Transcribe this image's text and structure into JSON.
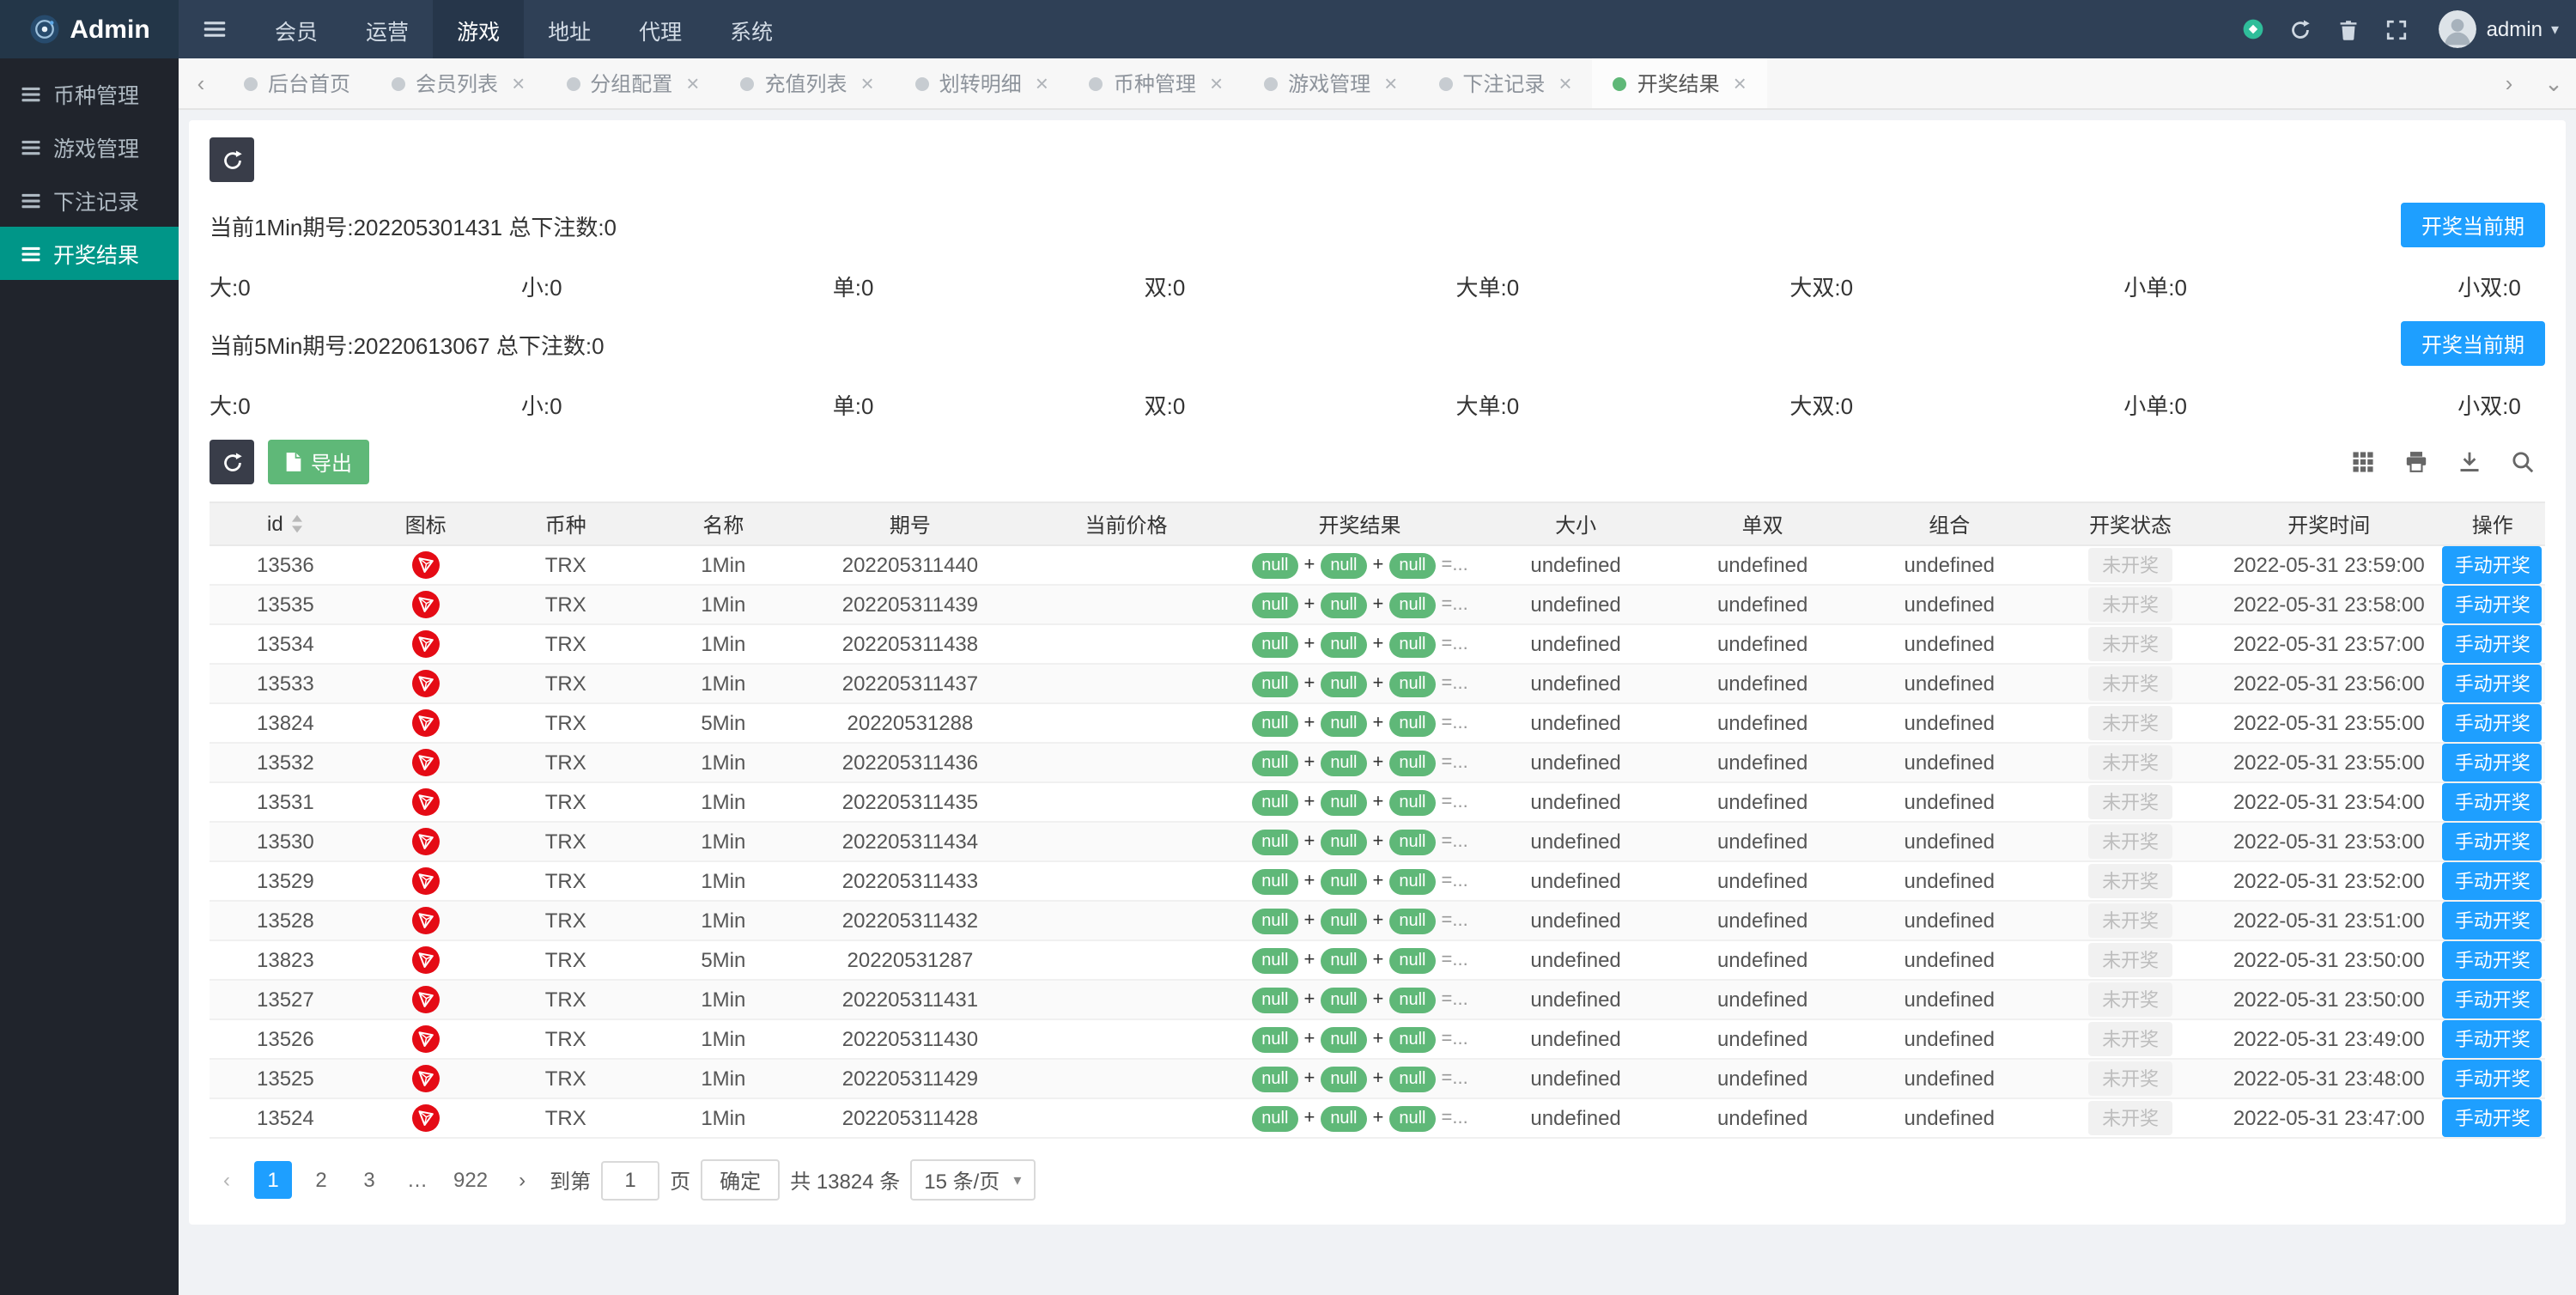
{
  "navbar": {
    "brand": "Admin",
    "items": [
      {
        "label": "会员",
        "active": false
      },
      {
        "label": "运营",
        "active": false
      },
      {
        "label": "游戏",
        "active": true
      },
      {
        "label": "地址",
        "active": false
      },
      {
        "label": "代理",
        "active": false
      },
      {
        "label": "系统",
        "active": false
      }
    ],
    "username": "admin"
  },
  "icons": {
    "menu-toggle": "hamburger",
    "theme": "teal-circle",
    "refresh": "refresh-arrows",
    "trash": "trash-can",
    "fullscreen": "expand-corners",
    "user-caret": "chevron-down",
    "sidebar-item": "list-bars",
    "tab-prev": "chevron-left",
    "tab-next": "chevron-right",
    "tab-menu": "chevron-down",
    "export": "file",
    "filter-columns": "grid",
    "print": "printer",
    "download": "download-tray",
    "search": "magnifier",
    "sort": "up-down-carets",
    "coin": "tron-logo",
    "prev-page": "chevron-left",
    "next-page": "chevron-right"
  },
  "sidebar": {
    "items": [
      {
        "label": "币种管理",
        "active": false
      },
      {
        "label": "游戏管理",
        "active": false
      },
      {
        "label": "下注记录",
        "active": false
      },
      {
        "label": "开奖结果",
        "active": true
      }
    ]
  },
  "tabbar": {
    "tabs": [
      {
        "label": "后台首页",
        "closable": false,
        "active": false
      },
      {
        "label": "会员列表",
        "closable": true,
        "active": false
      },
      {
        "label": "分组配置",
        "closable": true,
        "active": false
      },
      {
        "label": "充值列表",
        "closable": true,
        "active": false
      },
      {
        "label": "划转明细",
        "closable": true,
        "active": false
      },
      {
        "label": "币种管理",
        "closable": true,
        "active": false
      },
      {
        "label": "游戏管理",
        "closable": true,
        "active": false
      },
      {
        "label": "下注记录",
        "closable": true,
        "active": false
      },
      {
        "label": "开奖结果",
        "closable": true,
        "active": true
      }
    ]
  },
  "panel": {
    "periods": [
      {
        "info": "当前1Min期号:202205301431 总下注数:0",
        "draw_button": "开奖当前期",
        "stats": [
          "大:0",
          "小:0",
          "单:0",
          "双:0",
          "大单:0",
          "大双:0",
          "小单:0",
          "小双:0"
        ]
      },
      {
        "info": "当前5Min期号:20220613067 总下注数:0",
        "draw_button": "开奖当前期",
        "stats": [
          "大:0",
          "小:0",
          "单:0",
          "双:0",
          "大单:0",
          "大双:0",
          "小单:0",
          "小双:0"
        ]
      }
    ],
    "toolbar": {
      "export_label": "导出"
    },
    "table": {
      "headers": [
        {
          "label": "id",
          "sortable": true
        },
        {
          "label": "图标",
          "sortable": false
        },
        {
          "label": "币种",
          "sortable": false
        },
        {
          "label": "名称",
          "sortable": false
        },
        {
          "label": "期号",
          "sortable": false
        },
        {
          "label": "当前价格",
          "sortable": false
        },
        {
          "label": "开奖结果",
          "sortable": false
        },
        {
          "label": "大小",
          "sortable": false
        },
        {
          "label": "单双",
          "sortable": false
        },
        {
          "label": "组合",
          "sortable": false
        },
        {
          "label": "开奖状态",
          "sortable": false
        },
        {
          "label": "开奖时间",
          "sortable": false
        },
        {
          "label": "操作",
          "sortable": false
        }
      ],
      "result_plus": "+",
      "result_eq": "=...",
      "rows": [
        {
          "id": "13536",
          "icon": "trx",
          "coin": "TRX",
          "name": "1Min",
          "period": "202205311440",
          "price": "",
          "result": [
            "null",
            "null",
            "null"
          ],
          "size": "undefined",
          "parity": "undefined",
          "combo": "undefined",
          "status": "未开奖",
          "time": "2022-05-31 23:59:00",
          "action": "手动开奖"
        },
        {
          "id": "13535",
          "icon": "trx",
          "coin": "TRX",
          "name": "1Min",
          "period": "202205311439",
          "price": "",
          "result": [
            "null",
            "null",
            "null"
          ],
          "size": "undefined",
          "parity": "undefined",
          "combo": "undefined",
          "status": "未开奖",
          "time": "2022-05-31 23:58:00",
          "action": "手动开奖"
        },
        {
          "id": "13534",
          "icon": "trx",
          "coin": "TRX",
          "name": "1Min",
          "period": "202205311438",
          "price": "",
          "result": [
            "null",
            "null",
            "null"
          ],
          "size": "undefined",
          "parity": "undefined",
          "combo": "undefined",
          "status": "未开奖",
          "time": "2022-05-31 23:57:00",
          "action": "手动开奖"
        },
        {
          "id": "13533",
          "icon": "trx",
          "coin": "TRX",
          "name": "1Min",
          "period": "202205311437",
          "price": "",
          "result": [
            "null",
            "null",
            "null"
          ],
          "size": "undefined",
          "parity": "undefined",
          "combo": "undefined",
          "status": "未开奖",
          "time": "2022-05-31 23:56:00",
          "action": "手动开奖"
        },
        {
          "id": "13824",
          "icon": "trx",
          "coin": "TRX",
          "name": "5Min",
          "period": "20220531288",
          "price": "",
          "result": [
            "null",
            "null",
            "null"
          ],
          "size": "undefined",
          "parity": "undefined",
          "combo": "undefined",
          "status": "未开奖",
          "time": "2022-05-31 23:55:00",
          "action": "手动开奖"
        },
        {
          "id": "13532",
          "icon": "trx",
          "coin": "TRX",
          "name": "1Min",
          "period": "202205311436",
          "price": "",
          "result": [
            "null",
            "null",
            "null"
          ],
          "size": "undefined",
          "parity": "undefined",
          "combo": "undefined",
          "status": "未开奖",
          "time": "2022-05-31 23:55:00",
          "action": "手动开奖"
        },
        {
          "id": "13531",
          "icon": "trx",
          "coin": "TRX",
          "name": "1Min",
          "period": "202205311435",
          "price": "",
          "result": [
            "null",
            "null",
            "null"
          ],
          "size": "undefined",
          "parity": "undefined",
          "combo": "undefined",
          "status": "未开奖",
          "time": "2022-05-31 23:54:00",
          "action": "手动开奖"
        },
        {
          "id": "13530",
          "icon": "trx",
          "coin": "TRX",
          "name": "1Min",
          "period": "202205311434",
          "price": "",
          "result": [
            "null",
            "null",
            "null"
          ],
          "size": "undefined",
          "parity": "undefined",
          "combo": "undefined",
          "status": "未开奖",
          "time": "2022-05-31 23:53:00",
          "action": "手动开奖"
        },
        {
          "id": "13529",
          "icon": "trx",
          "coin": "TRX",
          "name": "1Min",
          "period": "202205311433",
          "price": "",
          "result": [
            "null",
            "null",
            "null"
          ],
          "size": "undefined",
          "parity": "undefined",
          "combo": "undefined",
          "status": "未开奖",
          "time": "2022-05-31 23:52:00",
          "action": "手动开奖"
        },
        {
          "id": "13528",
          "icon": "trx",
          "coin": "TRX",
          "name": "1Min",
          "period": "202205311432",
          "price": "",
          "result": [
            "null",
            "null",
            "null"
          ],
          "size": "undefined",
          "parity": "undefined",
          "combo": "undefined",
          "status": "未开奖",
          "time": "2022-05-31 23:51:00",
          "action": "手动开奖"
        },
        {
          "id": "13823",
          "icon": "trx",
          "coin": "TRX",
          "name": "5Min",
          "period": "20220531287",
          "price": "",
          "result": [
            "null",
            "null",
            "null"
          ],
          "size": "undefined",
          "parity": "undefined",
          "combo": "undefined",
          "status": "未开奖",
          "time": "2022-05-31 23:50:00",
          "action": "手动开奖"
        },
        {
          "id": "13527",
          "icon": "trx",
          "coin": "TRX",
          "name": "1Min",
          "period": "202205311431",
          "price": "",
          "result": [
            "null",
            "null",
            "null"
          ],
          "size": "undefined",
          "parity": "undefined",
          "combo": "undefined",
          "status": "未开奖",
          "time": "2022-05-31 23:50:00",
          "action": "手动开奖"
        },
        {
          "id": "13526",
          "icon": "trx",
          "coin": "TRX",
          "name": "1Min",
          "period": "202205311430",
          "price": "",
          "result": [
            "null",
            "null",
            "null"
          ],
          "size": "undefined",
          "parity": "undefined",
          "combo": "undefined",
          "status": "未开奖",
          "time": "2022-05-31 23:49:00",
          "action": "手动开奖"
        },
        {
          "id": "13525",
          "icon": "trx",
          "coin": "TRX",
          "name": "1Min",
          "period": "202205311429",
          "price": "",
          "result": [
            "null",
            "null",
            "null"
          ],
          "size": "undefined",
          "parity": "undefined",
          "combo": "undefined",
          "status": "未开奖",
          "time": "2022-05-31 23:48:00",
          "action": "手动开奖"
        },
        {
          "id": "13524",
          "icon": "trx",
          "coin": "TRX",
          "name": "1Min",
          "period": "202205311428",
          "price": "",
          "result": [
            "null",
            "null",
            "null"
          ],
          "size": "undefined",
          "parity": "undefined",
          "combo": "undefined",
          "status": "未开奖",
          "time": "2022-05-31 23:47:00",
          "action": "手动开奖"
        }
      ]
    },
    "pagination": {
      "pages": [
        "1",
        "2",
        "3",
        "…",
        "922"
      ],
      "active_page": "1",
      "jump_label": "到第",
      "jump_value": "1",
      "jump_unit": "页",
      "confirm_label": "确定",
      "total_label": "共 13824 条",
      "per_page_label": "15 条/页"
    }
  }
}
